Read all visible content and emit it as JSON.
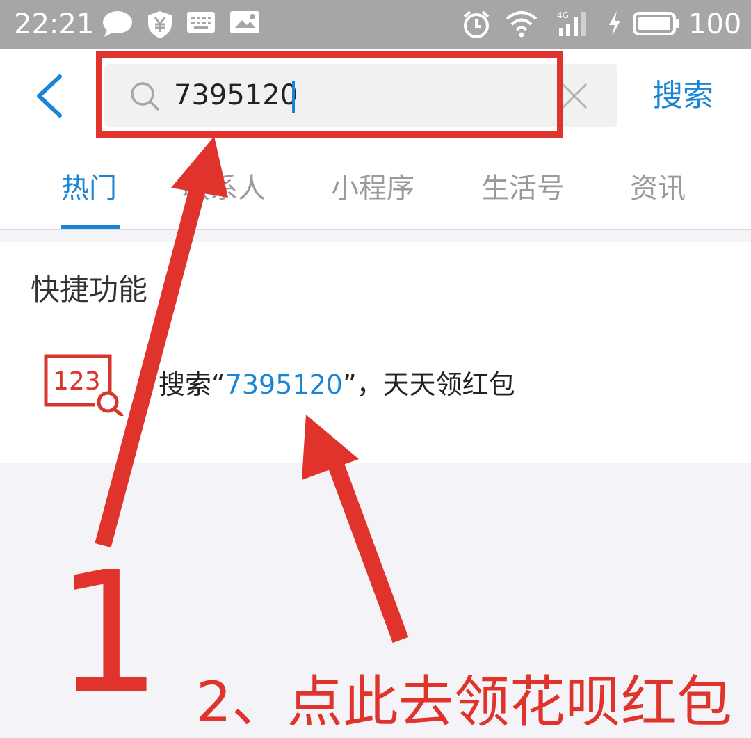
{
  "status_bar": {
    "time": "22:21",
    "battery": "100",
    "icons": [
      "chat-bubble-icon",
      "shield-yen-icon",
      "keyboard-icon",
      "image-icon",
      "alarm-icon",
      "wifi-icon",
      "signal-4g-icon",
      "charging-icon",
      "battery-icon"
    ],
    "network_label": "4G"
  },
  "header": {
    "search_value": "7395120",
    "search_button": "搜索"
  },
  "tabs": [
    {
      "label": "热门",
      "active": true
    },
    {
      "label": "联系人",
      "active": false
    },
    {
      "label": "小程序",
      "active": false
    },
    {
      "label": "生活号",
      "active": false
    },
    {
      "label": "资讯",
      "active": false
    }
  ],
  "quick": {
    "title": "快捷功能",
    "icon_text": "123",
    "item_prefix": "搜索“",
    "item_code": "7395120",
    "item_suffix": "”，天天领红包"
  },
  "annotations": {
    "number": "1",
    "instruction": "2、点此去领花呗红包",
    "color": "#e0332b"
  },
  "colors": {
    "accent": "#1a85d4",
    "status_bar": "#a6a6a6"
  }
}
